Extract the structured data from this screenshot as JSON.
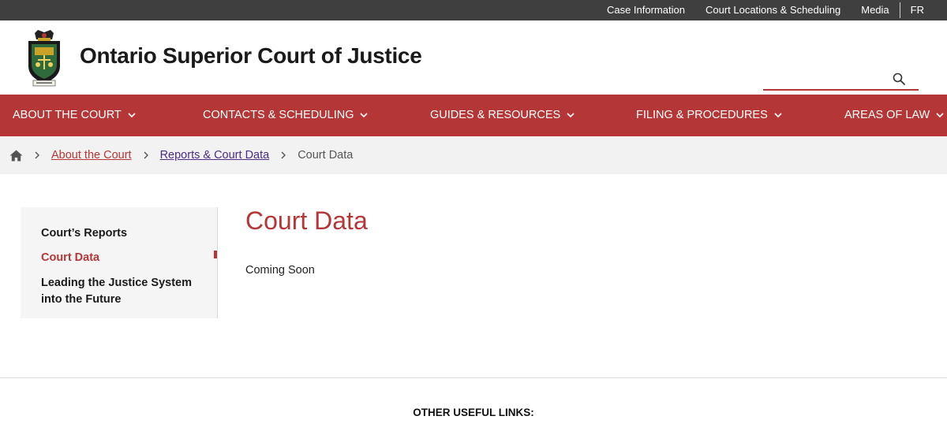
{
  "topbar": {
    "links": [
      "Case Information",
      "Court Locations & Scheduling",
      "Media",
      "FR"
    ]
  },
  "header": {
    "title": "Ontario Superior Court of Justice",
    "search_placeholder": "",
    "logo_icon": "court-crest-icon",
    "search_icon": "search-icon"
  },
  "nav": {
    "items": [
      "ABOUT THE COURT",
      "CONTACTS & SCHEDULING",
      "GUIDES & RESOURCES",
      "FILING & PROCEDURES",
      "AREAS OF LAW"
    ]
  },
  "breadcrumb": {
    "home_icon": "home-icon",
    "items": [
      "About the Court",
      "Reports & Court Data",
      "Court Data"
    ]
  },
  "sidebar": {
    "items": [
      "Court’s Reports",
      "Court Data",
      "Leading the Justice System into the Future"
    ]
  },
  "main": {
    "title": "Court Data",
    "body": "Coming Soon"
  },
  "footer": {
    "heading": "OTHER USEFUL LINKS:"
  },
  "colors": {
    "brand_red": "#b53637",
    "topbar": "#3f3f3f",
    "breadcrumb_bg": "#f2f2f2",
    "visited_link": "#4a2c82"
  }
}
